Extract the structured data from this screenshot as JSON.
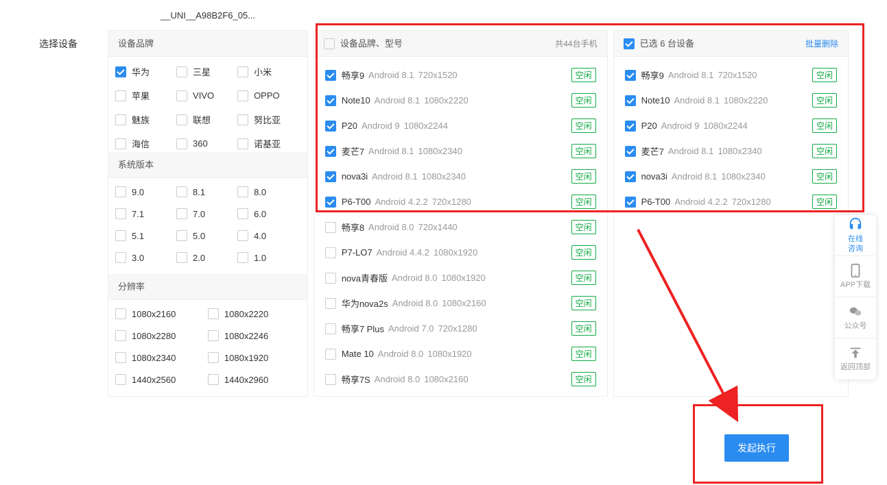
{
  "top_title": "__UNI__A98B2F6_05...",
  "label_select_device": "选择设备",
  "sections": {
    "brand_title": "设备品牌",
    "version_title": "系统版本",
    "resolution_title": "分辨率"
  },
  "brands": [
    {
      "name": "华为",
      "checked": true
    },
    {
      "name": "三星",
      "checked": false
    },
    {
      "name": "小米",
      "checked": false
    },
    {
      "name": "苹果",
      "checked": false
    },
    {
      "name": "VIVO",
      "checked": false
    },
    {
      "name": "OPPO",
      "checked": false
    },
    {
      "name": "魅族",
      "checked": false
    },
    {
      "name": "联想",
      "checked": false
    },
    {
      "name": "努比亚",
      "checked": false
    },
    {
      "name": "海信",
      "checked": false
    },
    {
      "name": "360",
      "checked": false
    },
    {
      "name": "诺基亚",
      "checked": false
    }
  ],
  "versions": [
    {
      "name": "9.0"
    },
    {
      "name": "8.1"
    },
    {
      "name": "8.0"
    },
    {
      "name": "7.1"
    },
    {
      "name": "7.0"
    },
    {
      "name": "6.0"
    },
    {
      "name": "5.1"
    },
    {
      "name": "5.0"
    },
    {
      "name": "4.0"
    },
    {
      "name": "3.0"
    },
    {
      "name": "2.0"
    },
    {
      "name": "1.0"
    }
  ],
  "resolutions": [
    {
      "name": "1080x2160"
    },
    {
      "name": "1080x2220"
    },
    {
      "name": "1080x2280"
    },
    {
      "name": "1080x2246"
    },
    {
      "name": "1080x2340"
    },
    {
      "name": "1080x1920"
    },
    {
      "name": "1440x2560"
    },
    {
      "name": "1440x2960"
    }
  ],
  "mid_header": {
    "title": "设备品牌、型号",
    "right": "共44台手机"
  },
  "status_label": "空闲",
  "devices": [
    {
      "name": "畅享9",
      "os": "Android 8.1",
      "res": "720x1520",
      "checked": true
    },
    {
      "name": "Note10",
      "os": "Android 8.1",
      "res": "1080x2220",
      "checked": true
    },
    {
      "name": "P20",
      "os": "Android 9",
      "res": "1080x2244",
      "checked": true
    },
    {
      "name": "麦芒7",
      "os": "Android 8.1",
      "res": "1080x2340",
      "checked": true
    },
    {
      "name": "nova3i",
      "os": "Android 8.1",
      "res": "1080x2340",
      "checked": true
    },
    {
      "name": "P6-T00",
      "os": "Android 4.2.2",
      "res": "720x1280",
      "checked": true
    },
    {
      "name": "畅享8",
      "os": "Android 8.0",
      "res": "720x1440",
      "checked": false
    },
    {
      "name": "P7-LO7",
      "os": "Android 4.4.2",
      "res": "1080x1920",
      "checked": false
    },
    {
      "name": "nova青春版",
      "os": "Android 8.0",
      "res": "1080x1920",
      "checked": false
    },
    {
      "name": "华为nova2s",
      "os": "Android 8.0",
      "res": "1080x2160",
      "checked": false
    },
    {
      "name": "畅享7 Plus",
      "os": "Android 7.0",
      "res": "720x1280",
      "checked": false
    },
    {
      "name": "Mate 10",
      "os": "Android 8.0",
      "res": "1080x1920",
      "checked": false
    },
    {
      "name": "畅享7S",
      "os": "Android 8.0",
      "res": "1080x2160",
      "checked": false
    }
  ],
  "right_header": {
    "title": "已选 6 台设备",
    "link": "批量删除"
  },
  "selected_devices": [
    {
      "name": "畅享9",
      "os": "Android 8.1",
      "res": "720x1520"
    },
    {
      "name": "Note10",
      "os": "Android 8.1",
      "res": "1080x2220"
    },
    {
      "name": "P20",
      "os": "Android 9",
      "res": "1080x2244"
    },
    {
      "name": "麦芒7",
      "os": "Android 8.1",
      "res": "1080x2340"
    },
    {
      "name": "nova3i",
      "os": "Android 8.1",
      "res": "1080x2340"
    },
    {
      "name": "P6-T00",
      "os": "Android 4.2.2",
      "res": "720x1280"
    }
  ],
  "submit_label": "发起执行",
  "side": {
    "chat": "在线\n咨询",
    "app": "APP下载",
    "wechat": "公众号",
    "top": "返回顶部"
  }
}
